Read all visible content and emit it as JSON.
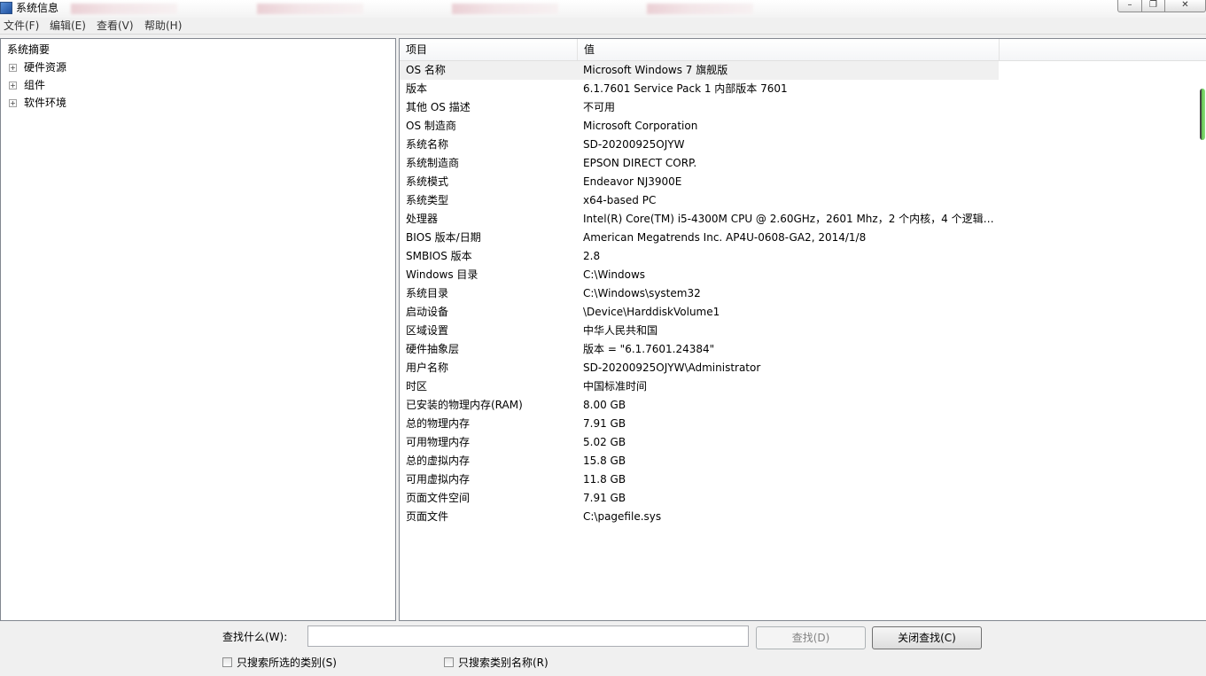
{
  "window": {
    "title": "系统信息"
  },
  "menu": [
    "文件(F)",
    "编辑(E)",
    "查看(V)",
    "帮助(H)"
  ],
  "tree": {
    "root": "系统摘要",
    "nodes": [
      {
        "label": "硬件资源",
        "expander": "+"
      },
      {
        "label": "组件",
        "expander": "+"
      },
      {
        "label": "软件环境",
        "expander": "+"
      }
    ]
  },
  "list": {
    "headers": [
      "项目",
      "值"
    ],
    "rows": [
      [
        "OS 名称",
        "Microsoft Windows 7 旗舰版"
      ],
      [
        "版本",
        "6.1.7601 Service Pack 1 内部版本 7601"
      ],
      [
        "其他 OS 描述",
        "不可用"
      ],
      [
        "OS 制造商",
        "Microsoft Corporation"
      ],
      [
        "系统名称",
        "SD-20200925OJYW"
      ],
      [
        "系统制造商",
        "EPSON DIRECT CORP."
      ],
      [
        "系统模式",
        "Endeavor NJ3900E"
      ],
      [
        "系统类型",
        "x64-based PC"
      ],
      [
        "处理器",
        "Intel(R) Core(TM) i5-4300M CPU @ 2.60GHz，2601 Mhz，2 个内核，4 个逻辑处..."
      ],
      [
        "BIOS 版本/日期",
        "American Megatrends Inc. AP4U-0608-GA2, 2014/1/8"
      ],
      [
        "SMBIOS 版本",
        "2.8"
      ],
      [
        "Windows 目录",
        "C:\\Windows"
      ],
      [
        "系统目录",
        "C:\\Windows\\system32"
      ],
      [
        "启动设备",
        "\\Device\\HarddiskVolume1"
      ],
      [
        "区域设置",
        "中华人民共和国"
      ],
      [
        "硬件抽象层",
        "版本 = \"6.1.7601.24384\""
      ],
      [
        "用户名称",
        "SD-20200925OJYW\\Administrator"
      ],
      [
        "时区",
        "中国标准时间"
      ],
      [
        "已安装的物理内存(RAM)",
        "8.00 GB"
      ],
      [
        "总的物理内存",
        "7.91 GB"
      ],
      [
        "可用物理内存",
        "5.02 GB"
      ],
      [
        "总的虚拟内存",
        "15.8 GB"
      ],
      [
        "可用虚拟内存",
        "11.8 GB"
      ],
      [
        "页面文件空间",
        "7.91 GB"
      ],
      [
        "页面文件",
        "C:\\pagefile.sys"
      ]
    ]
  },
  "find": {
    "label": "查找什么(W):",
    "value": "",
    "find_button": "查找(D)",
    "close_button": "关闭查找(C)",
    "checkbox_selected": "只搜索所选的类别(S)",
    "checkbox_names": "只搜索类别名称(R)"
  }
}
